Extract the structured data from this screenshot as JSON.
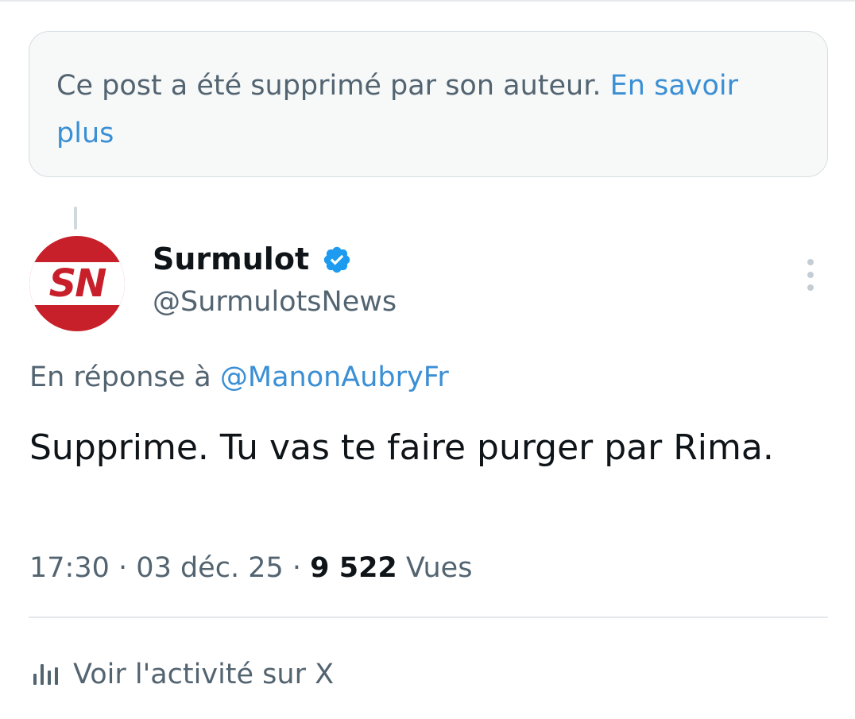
{
  "deleted_notice": {
    "text": "Ce post a été supprimé par son auteur.",
    "link": "En savoir plus"
  },
  "author": {
    "avatar_text": "SN",
    "display_name": "Surmulot",
    "handle": "@SurmulotsNews",
    "verified": true
  },
  "reply": {
    "prefix": "En réponse à",
    "mention": "@ManonAubryFr"
  },
  "post": {
    "text": "Supprime. Tu vas te faire purger par Rima."
  },
  "meta": {
    "time": "17:30",
    "date": "03 déc. 25",
    "views_count": "9 522",
    "views_label": "Vues",
    "separator": "·"
  },
  "activity": {
    "label": "Voir l'activité sur X"
  },
  "icons": {
    "verified": "verified-badge-icon",
    "more": "more-vertical-icon",
    "activity": "bar-chart-icon"
  },
  "colors": {
    "accent": "#1d9bf0",
    "link": "#3b8fd4",
    "muted": "#536471",
    "text": "#0f1419",
    "avatar_red": "#c8202a"
  }
}
